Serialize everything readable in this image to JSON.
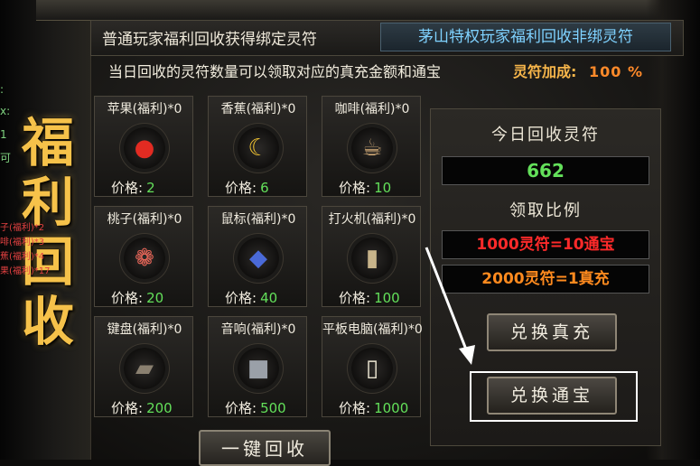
{
  "tabs": {
    "normal": "普通玩家福利回收获得绑定灵符",
    "privileged": "茅山特权玩家福利回收非绑灵符"
  },
  "notice": {
    "text": "当日回收的灵符数量可以领取对应的真充金额和通宝",
    "bonus_label": "灵符加成:",
    "bonus_value": "100 %"
  },
  "sidebar": {
    "title_chars": [
      "福",
      "利",
      "回",
      "收"
    ],
    "log_lines": [
      "子(福利)*2",
      "啡(福利)*3",
      "蕉(福利)*4",
      "果(福利)*17"
    ],
    "stats": [
      ":",
      "x:",
      "1",
      "可"
    ]
  },
  "items": [
    {
      "name": "苹果(福利)*0",
      "price_label": "价格:",
      "price": "2",
      "icon": "apple-icon"
    },
    {
      "name": "香蕉(福利)*0",
      "price_label": "价格:",
      "price": "6",
      "icon": "banana-icon"
    },
    {
      "name": "咖啡(福利)*0",
      "price_label": "价格:",
      "price": "10",
      "icon": "coffee-icon"
    },
    {
      "name": "桃子(福利)*0",
      "price_label": "价格:",
      "price": "20",
      "icon": "peach-icon"
    },
    {
      "name": "鼠标(福利)*0",
      "price_label": "价格:",
      "price": "40",
      "icon": "mouse-icon"
    },
    {
      "name": "打火机(福利)*0",
      "price_label": "价格:",
      "price": "100",
      "icon": "lighter-icon"
    },
    {
      "name": "键盘(福利)*0",
      "price_label": "价格:",
      "price": "200",
      "icon": "keyboard-icon"
    },
    {
      "name": "音响(福利)*0",
      "price_label": "价格:",
      "price": "500",
      "icon": "speaker-icon"
    },
    {
      "name": "平板电脑(福利)*0",
      "price_label": "价格:",
      "price": "1000",
      "icon": "tablet-icon"
    }
  ],
  "collect_button": "一键回收",
  "panel": {
    "today_heading": "今日回收灵符",
    "today_value": "662",
    "ratio_heading": "领取比例",
    "ratio_1": "1000灵符=10通宝",
    "ratio_2": "2000灵符=1真充",
    "exchange_real_button": "兑换真充",
    "exchange_coin_button": "兑换通宝"
  },
  "colors": {
    "accent_gold": "#f6c24a",
    "price_green": "#63e05a",
    "ratio_red": "#ff2a2a",
    "ratio_orange": "#ff8a1e",
    "tab_blue": "#7fd2ff"
  }
}
